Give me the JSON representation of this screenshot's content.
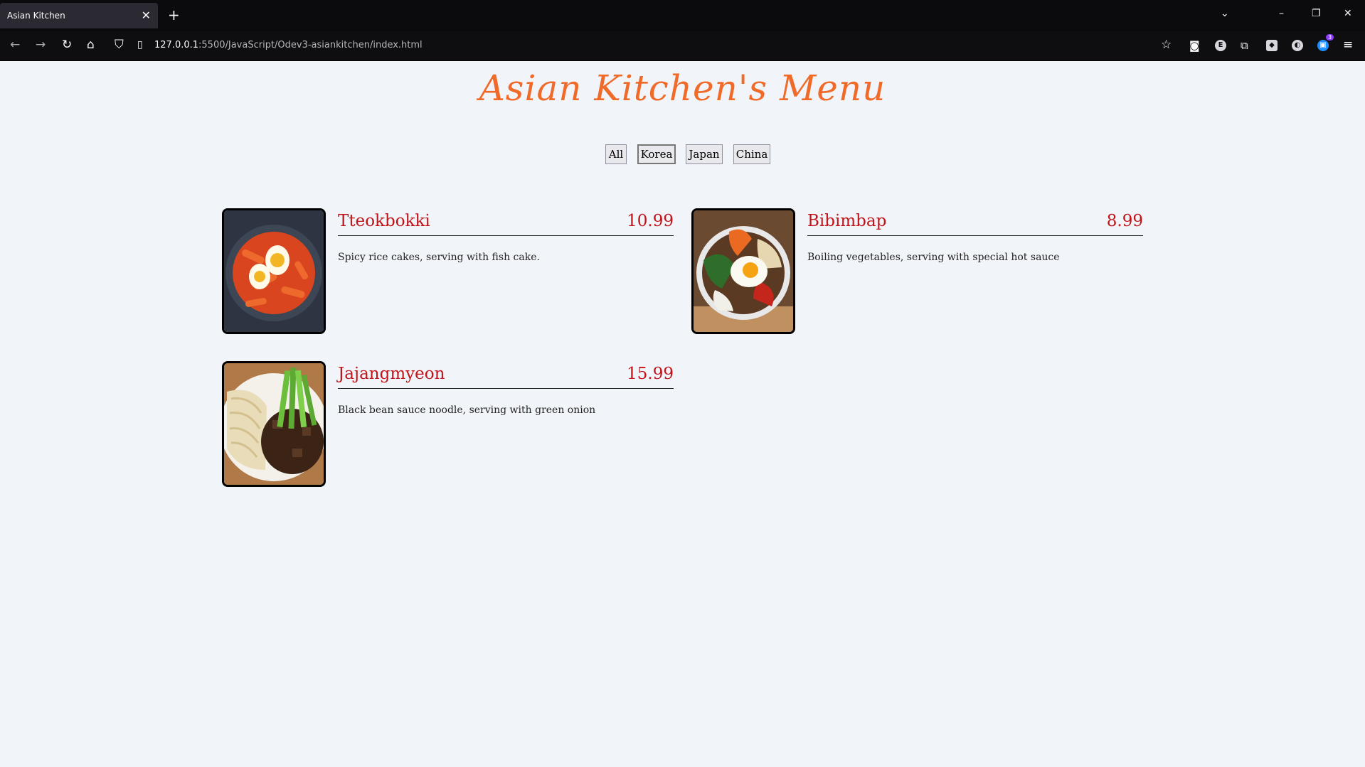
{
  "browser": {
    "tab_title": "Asian Kitchen",
    "url_host": "127.0.0.1",
    "url_rest": ":5500/JavaScript/Odev3-asiankitchen/index.html",
    "extension_badge": "3"
  },
  "page": {
    "title": "Asian Kitchen's Menu"
  },
  "filters": [
    "All",
    "Korea",
    "Japan",
    "China"
  ],
  "active_filter": "Korea",
  "menu": [
    {
      "name": "Tteokbokki",
      "price": "10.99",
      "desc": "Spicy rice cakes, serving with fish cake.",
      "photo": "tteokbokki-photo"
    },
    {
      "name": "Bibimbap",
      "price": "8.99",
      "desc": "Boiling vegetables, serving with special hot sauce",
      "photo": "bibimbap-photo"
    },
    {
      "name": "Jajangmyeon",
      "price": "15.99",
      "desc": "Black bean sauce noodle, serving with green onion",
      "photo": "jajangmyeon-photo"
    }
  ],
  "colors": {
    "title": "#f06a2a",
    "item_text": "#c0141a",
    "background": "#f1f4f8"
  }
}
